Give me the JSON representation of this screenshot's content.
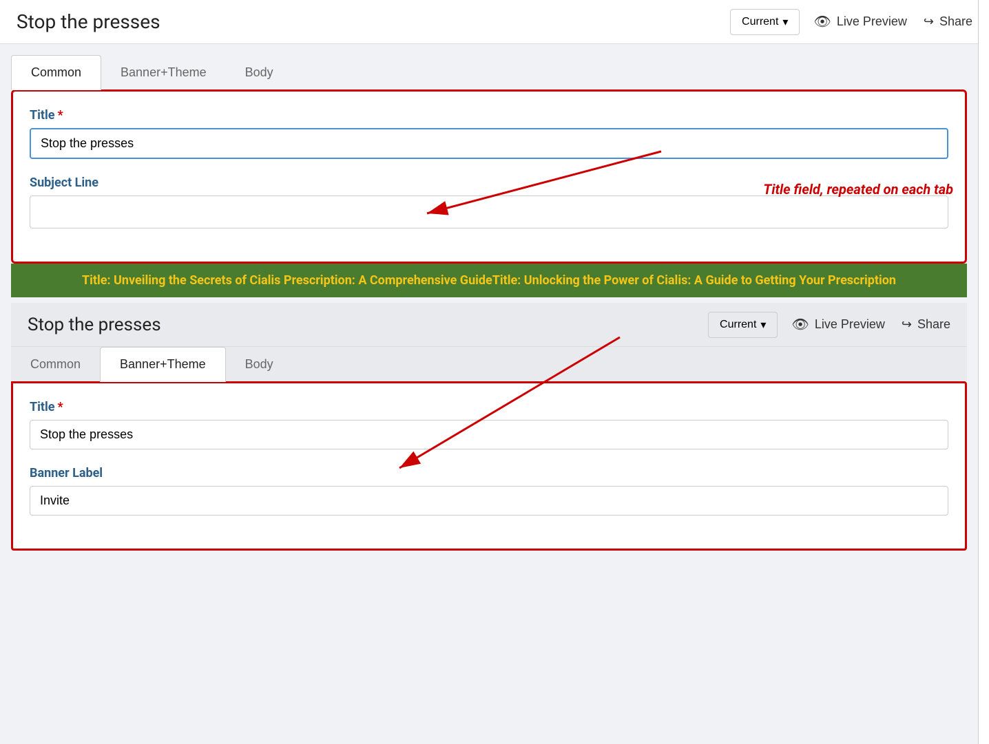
{
  "header": {
    "title": "Stop the presses",
    "version_label": "Current",
    "version_chevron": "▾",
    "live_preview_label": "Live Preview",
    "share_label": "Share"
  },
  "panel1": {
    "tabs": [
      {
        "label": "Common",
        "active": true
      },
      {
        "label": "Banner+Theme",
        "active": false
      },
      {
        "label": "Body",
        "active": false
      }
    ],
    "title_label": "Title",
    "title_required": "✦",
    "title_value": "Stop the presses",
    "subject_line_label": "Subject Line",
    "subject_line_value": ""
  },
  "panel2": {
    "tabs": [
      {
        "label": "Common",
        "active": false
      },
      {
        "label": "Banner+Theme",
        "active": true
      },
      {
        "label": "Body",
        "active": false
      }
    ],
    "title_label": "Title",
    "title_required": "✦",
    "title_value": "Stop the presses",
    "banner_label": "Banner Label",
    "banner_value": "Invite"
  },
  "annotation": {
    "green_banner_text": "Title: Unveiling the Secrets of Cialis Prescription: A Comprehensive GuideTitle: Unlocking the Power of Cialis: A Guide to Getting Your Prescription",
    "red_annotation_text": "Title field, repeated on each tab"
  }
}
